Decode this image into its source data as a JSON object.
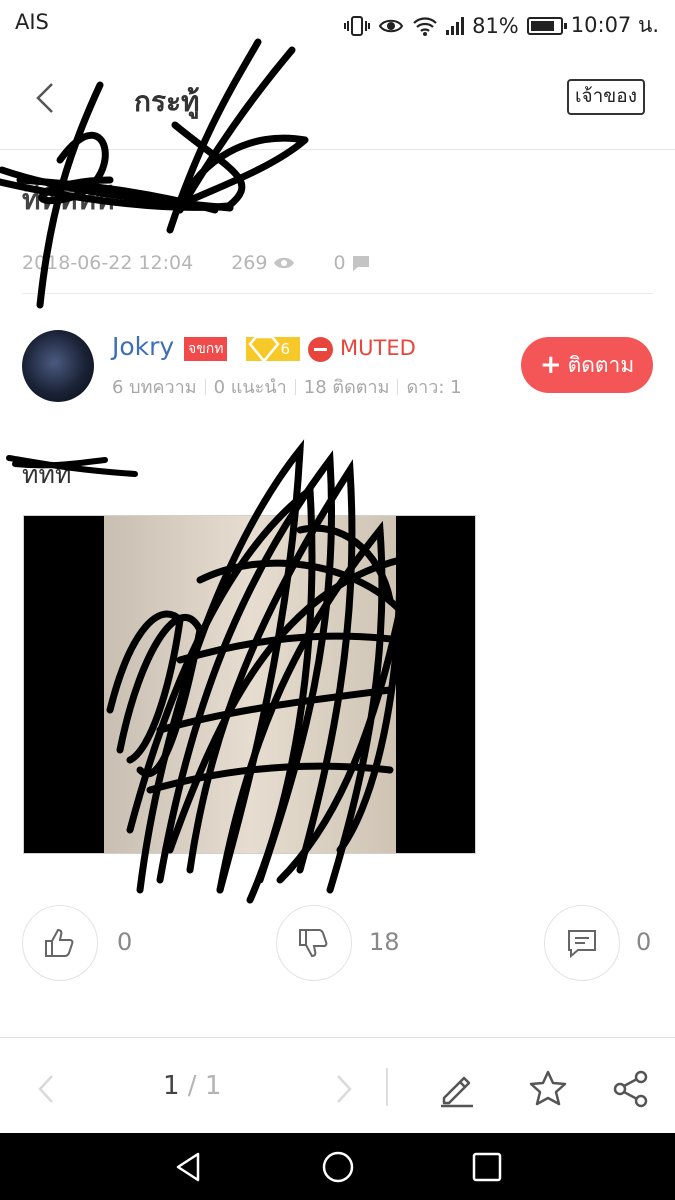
{
  "status_bar": {
    "carrier": "AIS",
    "battery": "81%",
    "time": "10:07 น."
  },
  "header": {
    "title": "กระทู้",
    "owner_button": "เจ้าของ"
  },
  "post": {
    "title": "ทีทีทีทีที",
    "date": "2018-06-22 12:04",
    "views": "269",
    "comments": "0",
    "body_text": "ทีทีที"
  },
  "author": {
    "name": "Jokry",
    "role_badge": "จขกท",
    "level": "6",
    "status": "MUTED",
    "stats": {
      "articles": "6 บทความ",
      "recommendations": "0 แนะนำ",
      "following": "18 ติดตาม",
      "stars": "ดาว: 1"
    },
    "follow_button": "ติดตาม"
  },
  "reactions": {
    "likes": "0",
    "dislikes": "18",
    "comments": "0"
  },
  "pagination": {
    "current": "1",
    "separator": " / ",
    "total": "1"
  },
  "colors": {
    "accent_red": "#f45657",
    "muted_red": "#e8453c",
    "link_blue": "#3d6fb4",
    "badge_gold": "#f7c928"
  },
  "icons": {
    "back": "chevron-left-icon",
    "views": "eye-icon",
    "comments": "comment-icon",
    "like": "thumbs-up-icon",
    "dislike": "thumbs-down-icon",
    "reply": "message-icon",
    "edit": "pencil-icon",
    "favorite": "star-icon",
    "share": "share-icon"
  }
}
